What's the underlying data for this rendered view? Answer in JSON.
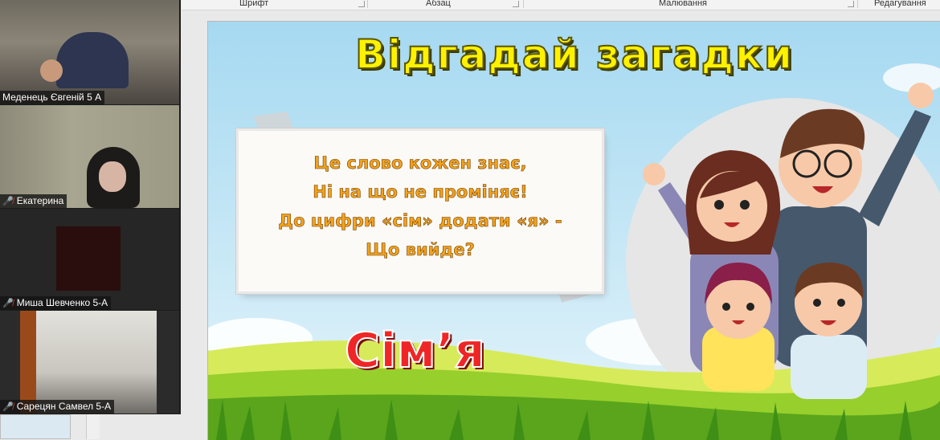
{
  "ribbon": {
    "groups": [
      "Шрифт",
      "Абзац",
      "Малювання",
      "Редагування"
    ]
  },
  "participants": [
    {
      "name": "Меденець Євгеній 5 А",
      "muted": false
    },
    {
      "name": "Екатерина",
      "muted": true
    },
    {
      "name": "Миша Шевченко 5-А",
      "muted": true
    },
    {
      "name": "Сарецян Самвел 5-А",
      "muted": true
    }
  ],
  "slide": {
    "title": "Відгадай загадки",
    "riddle": [
      "Це слово кожен знає,",
      "Ні на що не проміняє!",
      "До цифри «сім» додати «я» -",
      "Що вийде?"
    ],
    "answer": "Сім’я"
  },
  "colors": {
    "title": "#fff200",
    "riddle_text": "#f2a21c",
    "answer": "#ef2626",
    "sky": "#a6d9f1",
    "grass": "#7fc21c"
  }
}
